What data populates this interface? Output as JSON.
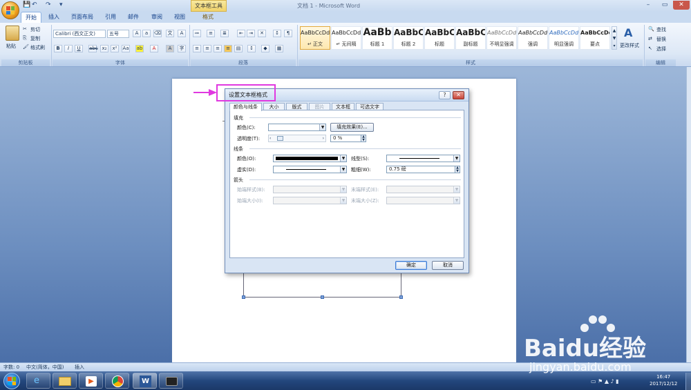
{
  "window": {
    "title": "文档 1 - Microsoft Word",
    "context_tab_group": "文本框工具"
  },
  "tabs": [
    "开始",
    "插入",
    "页面布局",
    "引用",
    "邮件",
    "审阅",
    "视图",
    "格式"
  ],
  "ribbon": {
    "clipboard": {
      "paste": "粘贴",
      "cut": "剪切",
      "copy": "复制",
      "format_painter": "格式刷",
      "label": "剪贴板"
    },
    "font": {
      "name": "Calibri (西文正文)",
      "size": "五号",
      "label": "字体"
    },
    "paragraph": {
      "label": "段落"
    },
    "styles": {
      "items": [
        {
          "sample": "AaBbCcDd",
          "caption": "↵ 正文"
        },
        {
          "sample": "AaBbCcDd",
          "caption": "↵ 无间隔"
        },
        {
          "sample": "AaBb",
          "caption": "标题 1"
        },
        {
          "sample": "AaBbC",
          "caption": "标题 2"
        },
        {
          "sample": "AaBbC",
          "caption": "标题"
        },
        {
          "sample": "AaBbC",
          "caption": "副标题"
        },
        {
          "sample": "AaBbCcDd",
          "caption": "不明显强调"
        },
        {
          "sample": "AaBbCcDd",
          "caption": "强调"
        },
        {
          "sample": "AaBbCcDd",
          "caption": "明显强调"
        },
        {
          "sample": "AaBbCcDd",
          "caption": "要点"
        }
      ],
      "change_styles": "更改样式",
      "label": "样式"
    },
    "editing": {
      "find": "查找",
      "replace": "替换",
      "select": "选择",
      "label": "编辑"
    }
  },
  "dialog": {
    "title": "设置文本框格式",
    "tabs": [
      "颜色与线条",
      "大小",
      "版式",
      "图片",
      "文本框",
      "可选文字"
    ],
    "fill": {
      "section": "填充",
      "color_label": "颜色(C):",
      "fill_effects_button": "填充效果(E)...",
      "transparency_label": "透明度(T):",
      "transparency_value": "0 %"
    },
    "line": {
      "section": "线条",
      "color_label": "颜色(O):",
      "dash_label": "虚实(D):",
      "style_label": "线型(S):",
      "weight_label": "粗细(W):",
      "weight_value": "0.75 磅"
    },
    "arrows": {
      "section": "箭头",
      "begin_style": "始端样式(B):",
      "end_style": "末端样式(E):",
      "begin_size": "始端大小(I):",
      "end_size": "末端大小(Z):"
    },
    "ok": "确定",
    "cancel": "取消"
  },
  "status": {
    "words": "字数: 0",
    "language": "中文(简体，中国)",
    "mode": "插入"
  },
  "taskbar": {
    "time": "16:47",
    "date": "2017/12/12"
  },
  "watermark": {
    "brand": "Baidu经验",
    "url": "jingyan.baidu.com"
  },
  "colors": {
    "annotation": "#e038e0",
    "ribbon_accent": "#15428b"
  }
}
